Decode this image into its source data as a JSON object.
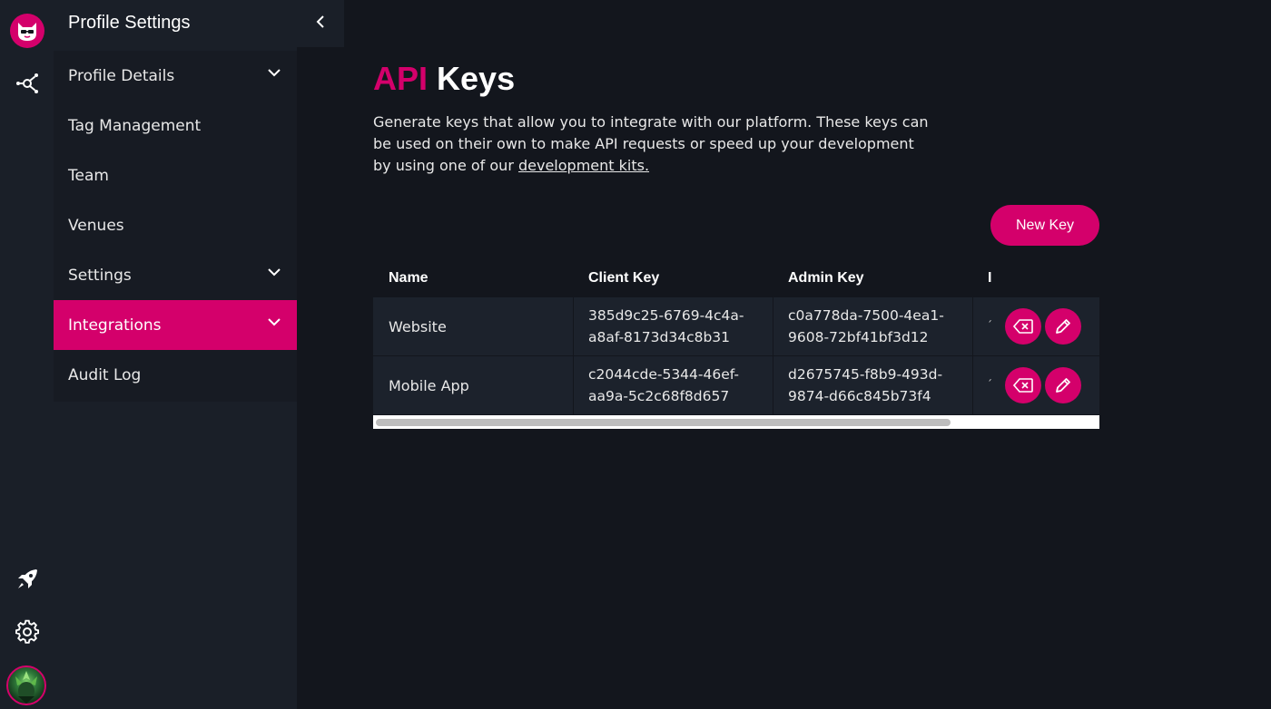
{
  "rail": {
    "icons": [
      "cat-logo-icon",
      "network-icon",
      "rocket-icon",
      "gear-icon",
      "avatar"
    ]
  },
  "menu": {
    "title": "Profile Settings",
    "items": [
      {
        "label": "Profile Details",
        "expandable": true,
        "active": false
      },
      {
        "label": "Tag Management",
        "expandable": false,
        "active": false
      },
      {
        "label": "Team",
        "expandable": false,
        "active": false
      },
      {
        "label": "Venues",
        "expandable": false,
        "active": false
      },
      {
        "label": "Settings",
        "expandable": true,
        "active": false
      },
      {
        "label": "Integrations",
        "expandable": true,
        "active": true
      },
      {
        "label": "Audit Log",
        "expandable": false,
        "active": false
      }
    ]
  },
  "page": {
    "title_accent": "API",
    "title_rest": "Keys",
    "intro_text": "Generate keys that allow you to integrate with our platform. These keys can be used on their own to make API requests or speed up your development by using one of our ",
    "intro_link": "development kits.",
    "new_key_label": "New Key"
  },
  "table": {
    "headers": [
      "Name",
      "Client Key",
      "Admin Key",
      "I"
    ],
    "rows": [
      {
        "name": "Website",
        "client_key_1": "385d9c25-6769-4c4a-",
        "client_key_2": "a8af-8173d34c8b31",
        "admin_key_1": "c0a778da-7500-4ea1-",
        "admin_key_2": "9608-72bf41bf3d12",
        "clipped": "´"
      },
      {
        "name": "Mobile App",
        "client_key_1": "c2044cde-5344-46ef-",
        "client_key_2": "aa9a-5c2c68f8d657",
        "admin_key_1": "d2675745-f8b9-493d-",
        "admin_key_2": "9874-d66c845b73f4",
        "clipped": "´"
      }
    ]
  },
  "colors": {
    "accent": "#d4006b",
    "background": "#13161d",
    "panel": "#1a1f28",
    "row": "#1c222c"
  }
}
